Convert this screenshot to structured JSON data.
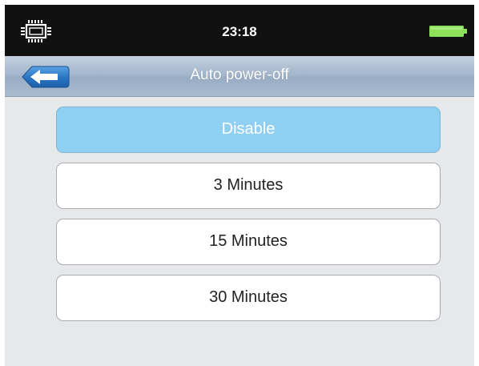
{
  "status_bar": {
    "time": "23:18",
    "left_icon": "chip-icon",
    "right_icon": "battery-icon",
    "battery_color": "#8ee05a"
  },
  "header": {
    "title": "Auto power-off",
    "back_icon": "back-arrow-icon"
  },
  "options": [
    {
      "label": "Disable",
      "selected": true
    },
    {
      "label": "3 Minutes",
      "selected": false
    },
    {
      "label": "15 Minutes",
      "selected": false
    },
    {
      "label": "30 Minutes",
      "selected": false
    }
  ],
  "colors": {
    "selected_option": "#8fd0f2",
    "title_bar": "#a4b7cd",
    "status_bar": "#111111"
  }
}
